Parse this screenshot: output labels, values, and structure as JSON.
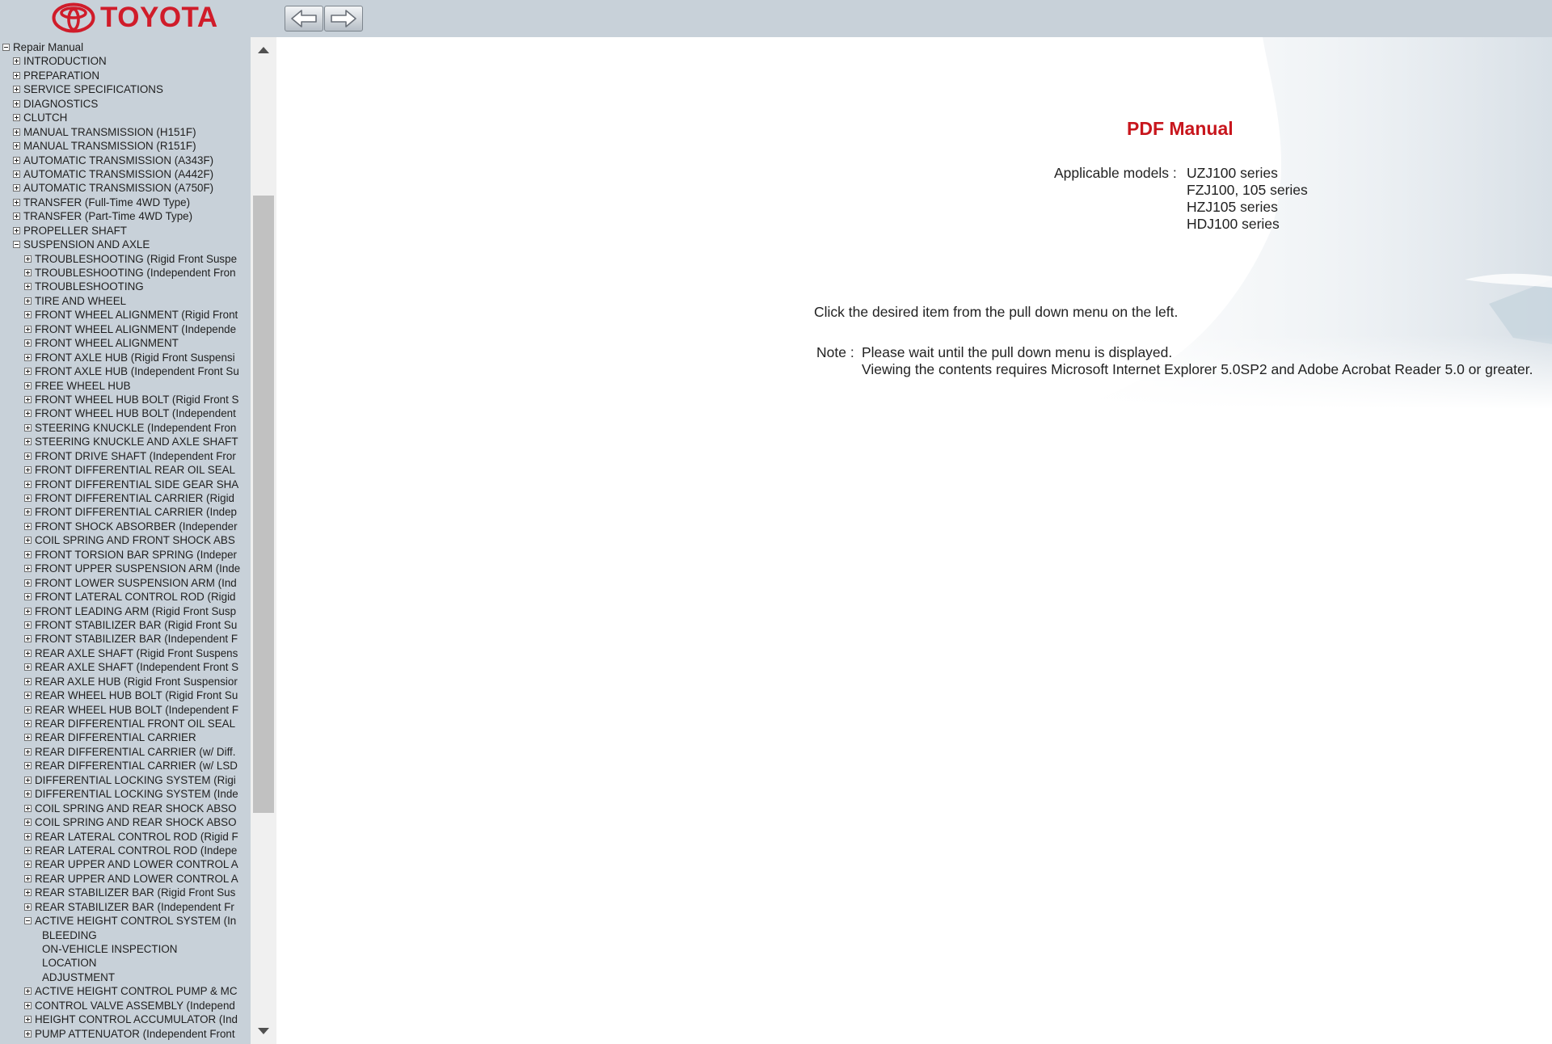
{
  "brand": {
    "name": "TOYOTA",
    "color": "#d01c2a"
  },
  "toolbar": {
    "back_icon": "arrow-left-icon",
    "forward_icon": "arrow-right-icon"
  },
  "tree": [
    {
      "label": "Repair Manual",
      "level": 0,
      "toggle": "minus"
    },
    {
      "label": "INTRODUCTION",
      "level": 1,
      "toggle": "plus"
    },
    {
      "label": "PREPARATION",
      "level": 1,
      "toggle": "plus"
    },
    {
      "label": "SERVICE SPECIFICATIONS",
      "level": 1,
      "toggle": "plus"
    },
    {
      "label": "DIAGNOSTICS",
      "level": 1,
      "toggle": "plus"
    },
    {
      "label": "CLUTCH",
      "level": 1,
      "toggle": "plus"
    },
    {
      "label": "MANUAL TRANSMISSION (H151F)",
      "level": 1,
      "toggle": "plus"
    },
    {
      "label": "MANUAL TRANSMISSION (R151F)",
      "level": 1,
      "toggle": "plus"
    },
    {
      "label": "AUTOMATIC TRANSMISSION (A343F)",
      "level": 1,
      "toggle": "plus"
    },
    {
      "label": "AUTOMATIC TRANSMISSION (A442F)",
      "level": 1,
      "toggle": "plus"
    },
    {
      "label": "AUTOMATIC TRANSMISSION (A750F)",
      "level": 1,
      "toggle": "plus"
    },
    {
      "label": "TRANSFER (Full-Time 4WD Type)",
      "level": 1,
      "toggle": "plus"
    },
    {
      "label": "TRANSFER (Part-Time 4WD Type)",
      "level": 1,
      "toggle": "plus"
    },
    {
      "label": "PROPELLER SHAFT",
      "level": 1,
      "toggle": "plus"
    },
    {
      "label": "SUSPENSION AND AXLE",
      "level": 1,
      "toggle": "minus"
    },
    {
      "label": "TROUBLESHOOTING (Rigid Front Suspe",
      "level": 2,
      "toggle": "plus"
    },
    {
      "label": "TROUBLESHOOTING (Independent Fron",
      "level": 2,
      "toggle": "plus"
    },
    {
      "label": "TROUBLESHOOTING",
      "level": 2,
      "toggle": "plus"
    },
    {
      "label": "TIRE AND WHEEL",
      "level": 2,
      "toggle": "plus"
    },
    {
      "label": "FRONT WHEEL ALIGNMENT (Rigid Front",
      "level": 2,
      "toggle": "plus"
    },
    {
      "label": "FRONT WHEEL ALIGNMENT (Independe",
      "level": 2,
      "toggle": "plus"
    },
    {
      "label": "FRONT WHEEL ALIGNMENT",
      "level": 2,
      "toggle": "plus"
    },
    {
      "label": "FRONT AXLE HUB (Rigid Front Suspensi",
      "level": 2,
      "toggle": "plus"
    },
    {
      "label": "FRONT AXLE HUB (Independent Front Su",
      "level": 2,
      "toggle": "plus"
    },
    {
      "label": "FREE WHEEL HUB",
      "level": 2,
      "toggle": "plus"
    },
    {
      "label": "FRONT WHEEL HUB BOLT (Rigid Front S",
      "level": 2,
      "toggle": "plus"
    },
    {
      "label": "FRONT WHEEL HUB BOLT (Independent",
      "level": 2,
      "toggle": "plus"
    },
    {
      "label": "STEERING KNUCKLE (Independent Fron",
      "level": 2,
      "toggle": "plus"
    },
    {
      "label": "STEERING KNUCKLE AND AXLE SHAFT",
      "level": 2,
      "toggle": "plus"
    },
    {
      "label": "FRONT DRIVE SHAFT (Independent Fror",
      "level": 2,
      "toggle": "plus"
    },
    {
      "label": "FRONT DIFFERENTIAL REAR OIL SEAL",
      "level": 2,
      "toggle": "plus"
    },
    {
      "label": "FRONT DIFFERENTIAL SIDE GEAR SHA",
      "level": 2,
      "toggle": "plus"
    },
    {
      "label": "FRONT DIFFERENTIAL CARRIER (Rigid",
      "level": 2,
      "toggle": "plus"
    },
    {
      "label": "FRONT DIFFERENTIAL CARRIER (Indep",
      "level": 2,
      "toggle": "plus"
    },
    {
      "label": "FRONT SHOCK ABSORBER (Independer",
      "level": 2,
      "toggle": "plus"
    },
    {
      "label": "COIL SPRING AND FRONT SHOCK ABS",
      "level": 2,
      "toggle": "plus"
    },
    {
      "label": "FRONT TORSION BAR SPRING (Indeper",
      "level": 2,
      "toggle": "plus"
    },
    {
      "label": "FRONT UPPER SUSPENSION ARM (Inde",
      "level": 2,
      "toggle": "plus"
    },
    {
      "label": "FRONT LOWER SUSPENSION ARM (Ind",
      "level": 2,
      "toggle": "plus"
    },
    {
      "label": "FRONT LATERAL CONTROL ROD (Rigid",
      "level": 2,
      "toggle": "plus"
    },
    {
      "label": "FRONT LEADING ARM (Rigid Front Susp",
      "level": 2,
      "toggle": "plus"
    },
    {
      "label": "FRONT STABILIZER BAR (Rigid Front Su",
      "level": 2,
      "toggle": "plus"
    },
    {
      "label": "FRONT STABILIZER BAR (Independent F",
      "level": 2,
      "toggle": "plus"
    },
    {
      "label": "REAR AXLE SHAFT (Rigid Front Suspens",
      "level": 2,
      "toggle": "plus"
    },
    {
      "label": "REAR AXLE SHAFT (Independent Front S",
      "level": 2,
      "toggle": "plus"
    },
    {
      "label": "REAR AXLE HUB (Rigid Front Suspensior",
      "level": 2,
      "toggle": "plus"
    },
    {
      "label": "REAR WHEEL HUB BOLT (Rigid Front Su",
      "level": 2,
      "toggle": "plus"
    },
    {
      "label": "REAR WHEEL HUB BOLT (Independent F",
      "level": 2,
      "toggle": "plus"
    },
    {
      "label": "REAR DIFFERENTIAL FRONT OIL SEAL",
      "level": 2,
      "toggle": "plus"
    },
    {
      "label": "REAR DIFFERENTIAL CARRIER",
      "level": 2,
      "toggle": "plus"
    },
    {
      "label": "REAR DIFFERENTIAL CARRIER (w/ Diff.",
      "level": 2,
      "toggle": "plus"
    },
    {
      "label": "REAR DIFFERENTIAL CARRIER (w/ LSD",
      "level": 2,
      "toggle": "plus"
    },
    {
      "label": "DIFFERENTIAL LOCKING SYSTEM (Rigi",
      "level": 2,
      "toggle": "plus"
    },
    {
      "label": "DIFFERENTIAL LOCKING SYSTEM (Inde",
      "level": 2,
      "toggle": "plus"
    },
    {
      "label": "COIL SPRING AND REAR SHOCK ABSO",
      "level": 2,
      "toggle": "plus"
    },
    {
      "label": "COIL SPRING AND REAR SHOCK ABSO",
      "level": 2,
      "toggle": "plus"
    },
    {
      "label": "REAR LATERAL CONTROL ROD (Rigid F",
      "level": 2,
      "toggle": "plus"
    },
    {
      "label": "REAR LATERAL CONTROL ROD (Indepe",
      "level": 2,
      "toggle": "plus"
    },
    {
      "label": "REAR UPPER AND LOWER CONTROL A",
      "level": 2,
      "toggle": "plus"
    },
    {
      "label": "REAR UPPER AND LOWER CONTROL A",
      "level": 2,
      "toggle": "plus"
    },
    {
      "label": "REAR STABILIZER BAR (Rigid Front Sus",
      "level": 2,
      "toggle": "plus"
    },
    {
      "label": "REAR STABILIZER BAR (Independent Fr",
      "level": 2,
      "toggle": "plus"
    },
    {
      "label": "ACTIVE HEIGHT CONTROL SYSTEM (In",
      "level": 2,
      "toggle": "minus"
    },
    {
      "label": "BLEEDING",
      "level": 3,
      "toggle": "none"
    },
    {
      "label": "ON-VEHICLE INSPECTION",
      "level": 3,
      "toggle": "none"
    },
    {
      "label": "LOCATION",
      "level": 3,
      "toggle": "none"
    },
    {
      "label": "ADJUSTMENT",
      "level": 3,
      "toggle": "none"
    },
    {
      "label": "ACTIVE HEIGHT CONTROL PUMP & MC",
      "level": 2,
      "toggle": "plus"
    },
    {
      "label": "CONTROL VALVE ASSEMBLY (Independ",
      "level": 2,
      "toggle": "plus"
    },
    {
      "label": "HEIGHT CONTROL ACCUMULATOR (Ind",
      "level": 2,
      "toggle": "plus"
    },
    {
      "label": "PUMP ATTENUATOR (Independent Front",
      "level": 2,
      "toggle": "plus"
    }
  ],
  "main": {
    "title": "PDF Manual",
    "title_color": "#c8161d",
    "models_label": "Applicable models :",
    "models": [
      "UZJ100 series",
      "FZJ100, 105 series",
      "HZJ105 series",
      "HDJ100 series"
    ],
    "instruction": "Click the desired item from the pull down menu on the left.",
    "note_label": "Note :",
    "note_lines": [
      "Please wait until the pull down menu is displayed.",
      "Viewing the contents requires Microsoft Internet Explorer 5.0SP2 and Adobe Acrobat Reader 5.0 or greater."
    ]
  },
  "colors": {
    "sidebar_bg": "#c8d1d9",
    "content_bg": "#ffffff"
  }
}
